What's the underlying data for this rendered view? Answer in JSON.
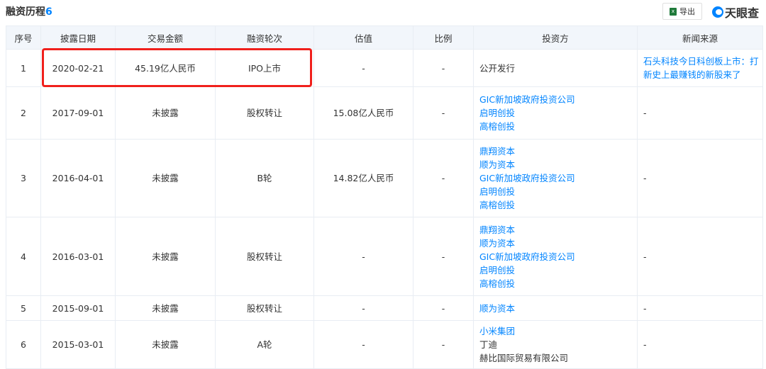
{
  "header": {
    "title": "融资历程",
    "count": "6",
    "export_label": "导出",
    "export_icon": "excel-icon",
    "brand": "天眼查"
  },
  "columns": [
    "序号",
    "披露日期",
    "交易金额",
    "融资轮次",
    "估值",
    "比例",
    "投资方",
    "新闻来源"
  ],
  "rows": [
    {
      "no": "1",
      "date": "2020-02-21",
      "amount": "45.19亿人民币",
      "round": "IPO上市",
      "valuation": "-",
      "ratio": "-",
      "investors": [
        {
          "name": "公开发行",
          "link": false
        }
      ],
      "news": {
        "text": "石头科技今日科创板上市：打新史上最赚钱的新股来了",
        "link": true
      }
    },
    {
      "no": "2",
      "date": "2017-09-01",
      "amount": "未披露",
      "round": "股权转让",
      "valuation": "15.08亿人民币",
      "ratio": "-",
      "investors": [
        {
          "name": "GIC新加坡政府投资公司",
          "link": true
        },
        {
          "name": "启明创投",
          "link": true
        },
        {
          "name": "高榕创投",
          "link": true
        }
      ],
      "news": {
        "text": "-",
        "link": false
      }
    },
    {
      "no": "3",
      "date": "2016-04-01",
      "amount": "未披露",
      "round": "B轮",
      "valuation": "14.82亿人民币",
      "ratio": "-",
      "investors": [
        {
          "name": "鼎翔资本",
          "link": true
        },
        {
          "name": "顺为资本",
          "link": true
        },
        {
          "name": "GIC新加坡政府投资公司",
          "link": true
        },
        {
          "name": "启明创投",
          "link": true
        },
        {
          "name": "高榕创投",
          "link": true
        }
      ],
      "news": {
        "text": "-",
        "link": false
      }
    },
    {
      "no": "4",
      "date": "2016-03-01",
      "amount": "未披露",
      "round": "股权转让",
      "valuation": "-",
      "ratio": "-",
      "investors": [
        {
          "name": "鼎翔资本",
          "link": true
        },
        {
          "name": "顺为资本",
          "link": true
        },
        {
          "name": "GIC新加坡政府投资公司",
          "link": true
        },
        {
          "name": "启明创投",
          "link": true
        },
        {
          "name": "高榕创投",
          "link": true
        }
      ],
      "news": {
        "text": "-",
        "link": false
      }
    },
    {
      "no": "5",
      "date": "2015-09-01",
      "amount": "未披露",
      "round": "股权转让",
      "valuation": "-",
      "ratio": "-",
      "investors": [
        {
          "name": "顺为资本",
          "link": true
        }
      ],
      "news": {
        "text": "-",
        "link": false
      }
    },
    {
      "no": "6",
      "date": "2015-03-01",
      "amount": "未披露",
      "round": "A轮",
      "valuation": "-",
      "ratio": "-",
      "investors": [
        {
          "name": "小米集团",
          "link": true
        },
        {
          "name": "丁迪",
          "link": false
        },
        {
          "name": "赫比国际贸易有限公司",
          "link": false
        }
      ],
      "news": {
        "text": "-",
        "link": false
      }
    }
  ]
}
